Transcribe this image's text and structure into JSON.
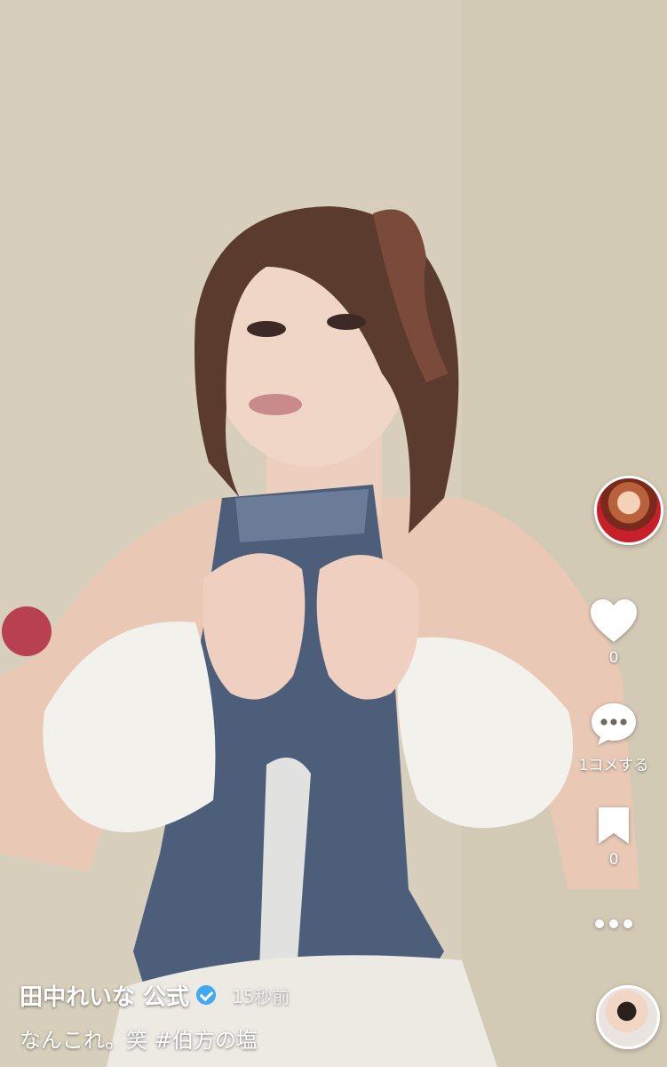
{
  "post": {
    "username": "田中れいな 公式",
    "time": "15秒前",
    "caption": "なんこれ。笑 #伯方の塩"
  },
  "actions": {
    "like_count": "0",
    "comment_label": "1コメする",
    "save_count": "0"
  },
  "icons": {
    "like": "heart-icon",
    "comment": "speech-bubble-icon",
    "save": "bookmark-icon",
    "more": "ellipsis-icon",
    "verified": "checkmark-badge-icon"
  },
  "colors": {
    "verified_badge": "#3fa9f5",
    "text": "#ffffff"
  }
}
